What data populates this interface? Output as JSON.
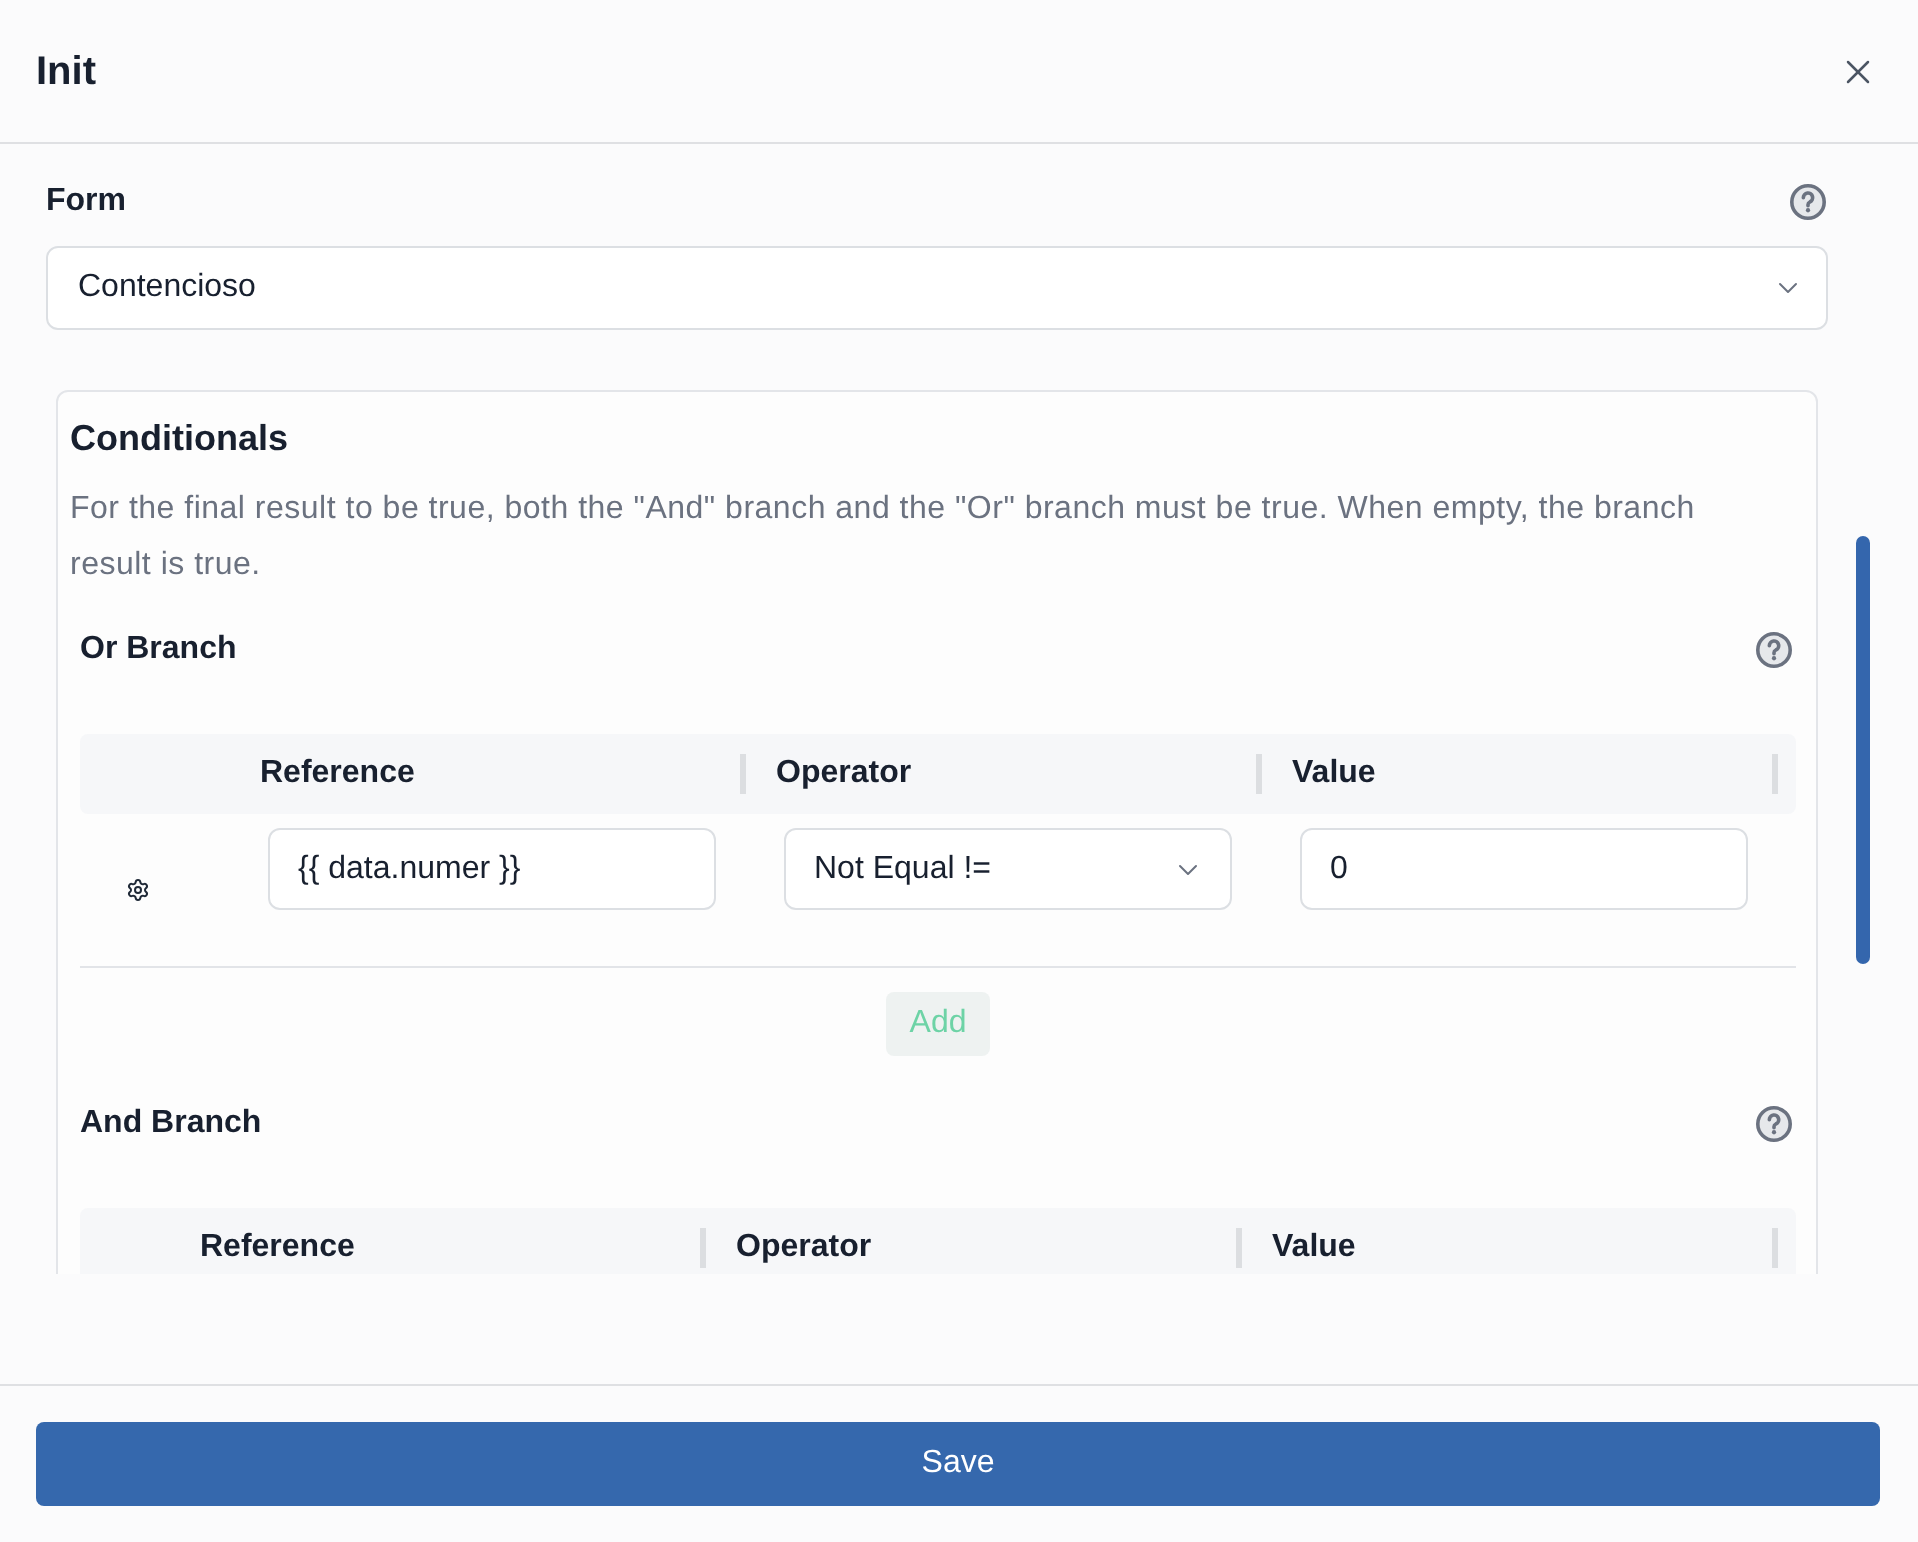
{
  "dialog": {
    "title": "Init"
  },
  "form_field": {
    "label": "Form",
    "value": "Contencioso"
  },
  "conditionals": {
    "title": "Conditionals",
    "description": "For the final result to be true, both the \"And\" branch and the \"Or\" branch must be true. When empty, the branch result is true.",
    "branches": [
      {
        "title": "Or Branch",
        "columns": [
          "Reference",
          "Operator",
          "Value"
        ],
        "rows": [
          {
            "reference": "{{ data.numer }}",
            "operator": "Not Equal !=",
            "value": "0"
          }
        ],
        "add_button": "Add"
      },
      {
        "title": "And Branch",
        "columns": [
          "Reference",
          "Operator",
          "Value"
        ]
      }
    ]
  },
  "footer": {
    "save_button": "Save"
  }
}
